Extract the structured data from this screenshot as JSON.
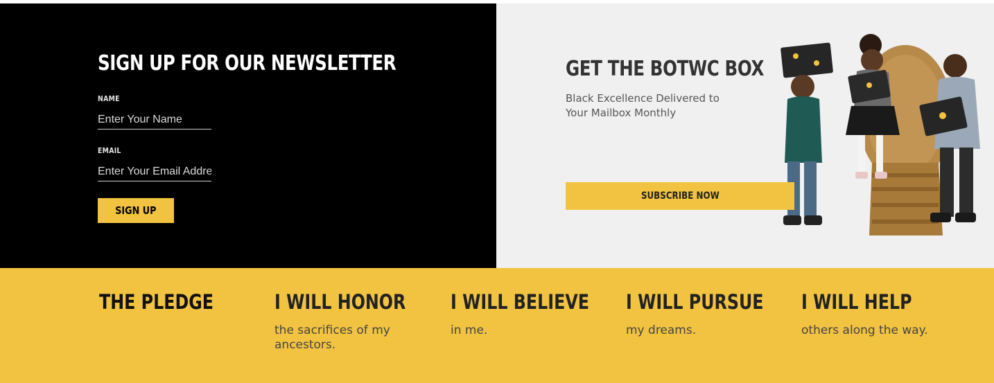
{
  "newsletter": {
    "title": "SIGN UP FOR OUR NEWSLETTER",
    "name_label": "NAME",
    "name_placeholder": "Enter Your Name",
    "email_label": "EMAIL",
    "email_placeholder": "Enter Your Email Address",
    "button_label": "SIGN UP"
  },
  "box_promo": {
    "title": "GET THE BOTWC BOX",
    "subtitle": "Black Excellence Delivered to Your Mailbox Monthly",
    "button_label": "SUBSCRIBE NOW"
  },
  "pledge": {
    "title": "THE PLEDGE",
    "items": [
      {
        "heading": "I WILL HONOR",
        "text": "the sacrifices of my ancestors."
      },
      {
        "heading": "I WILL BELIEVE",
        "text": "in me."
      },
      {
        "heading": "I WILL PURSUE",
        "text": "my dreams."
      },
      {
        "heading": "I WILL HELP",
        "text": "others along the way."
      }
    ]
  },
  "colors": {
    "accent_yellow": "#f2c340",
    "dark_panel": "#000000",
    "light_panel": "#f0f0f0"
  }
}
